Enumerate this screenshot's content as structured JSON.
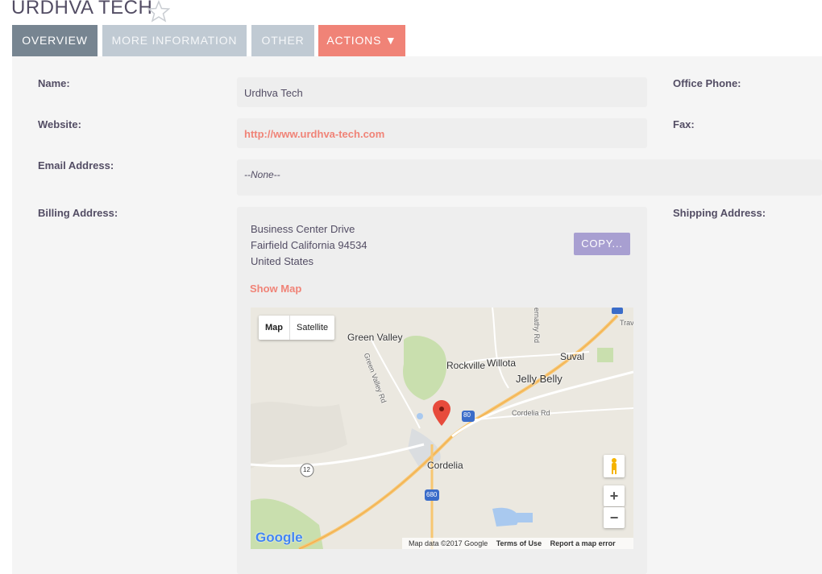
{
  "page": {
    "title": "URDHVA TECH"
  },
  "tabs": [
    {
      "label": "OVERVIEW"
    },
    {
      "label": "MORE INFORMATION"
    },
    {
      "label": "OTHER"
    },
    {
      "label": "ACTIONS ▼"
    }
  ],
  "fields": {
    "name_label": "Name:",
    "name_value": "Urdhva Tech",
    "website_label": "Website:",
    "website_value": "http://www.urdhva-tech.com",
    "email_label": "Email Address:",
    "email_value": "--None--",
    "billing_label": "Billing Address:",
    "office_phone_label": "Office Phone:",
    "fax_label": "Fax:",
    "shipping_label": "Shipping Address:"
  },
  "billing": {
    "street": "Business Center Drive",
    "city_line": "Fairfield California  94534",
    "country": "United States",
    "copy_label": "COPY...",
    "show_map": "Show Map"
  },
  "map": {
    "type_map": "Map",
    "type_satellite": "Satellite",
    "zoom_in": "+",
    "zoom_out": "−",
    "attribution": "Map data ©2017 Google",
    "terms": "Terms of Use",
    "report": "Report a map error",
    "logo": "Google",
    "places": {
      "green_valley": "Green Valley",
      "rockville": "Rockville",
      "willota": "Willota",
      "suval": "Suval",
      "jelly_belly": "Jelly Belly",
      "cordelia": "Cordelia",
      "green_valley_rd": "Green Valley Rd",
      "cordelia_rd": "Cordelia Rd",
      "abernathy_rd": "ernathy Rd",
      "trav": "Trav",
      "shield_80": "80",
      "shield_680": "680",
      "shield_12": "12"
    }
  },
  "colors": {
    "tab_active": "#778591",
    "tab_inactive": "#c0cad3",
    "tab_actions": "#f08377",
    "link": "#f08377",
    "copy_button": "#a89fd1"
  }
}
